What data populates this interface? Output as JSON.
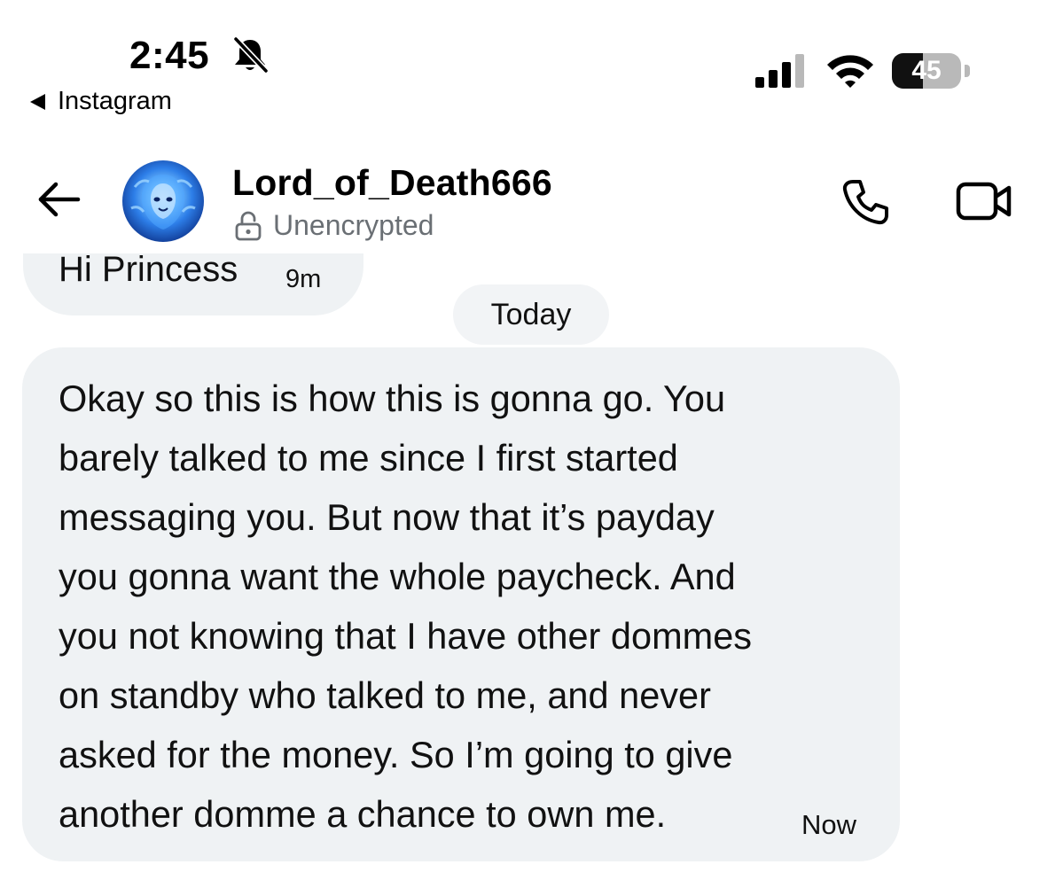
{
  "status_bar": {
    "time": "2:45",
    "back_app": "Instagram",
    "battery_level": "45",
    "battery_fraction": 0.45
  },
  "header": {
    "contact_name": "Lord_of_Death666",
    "encryption_status": "Unencrypted"
  },
  "icons": {
    "back": "arrow-back-icon",
    "call": "phone-icon",
    "video": "video-camera-icon",
    "lock": "lock-open-icon",
    "silent": "bell-off-icon"
  },
  "messages": {
    "previous": {
      "text": "Hi Princess",
      "time": "9m"
    },
    "date_separator": "Today",
    "latest": {
      "lines": [
        "Okay so this is how this is gonna go. You",
        "barely talked to me since I first started",
        "messaging you. But now that it’s payday",
        "you gonna want the whole paycheck. And",
        "you not knowing that I have other dommes",
        "on standby who talked to me, and never",
        "asked for the money. So I’m going to give",
        "another domme a chance to own me."
      ],
      "time": "Now"
    }
  },
  "colors": {
    "bubble": "#eff2f4",
    "secondary_text": "#6a6f74",
    "avatar_accent": "#2d7ee8"
  }
}
